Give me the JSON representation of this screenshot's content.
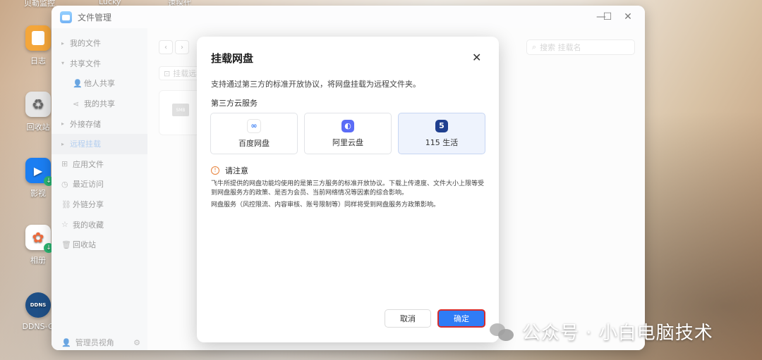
{
  "desktop": {
    "top_labels": [
      "贝勒监控",
      "Lucky",
      "速探代"
    ],
    "icons": [
      {
        "label": "日志",
        "name": "log-app-icon"
      },
      {
        "label": "回收站",
        "name": "recycle-bin-icon"
      },
      {
        "label": "影视",
        "name": "video-app-icon"
      },
      {
        "label": "相册",
        "name": "photos-app-icon"
      },
      {
        "label": "DDNS-G",
        "name": "ddns-app-icon",
        "badge": "DDNS"
      }
    ]
  },
  "window": {
    "title": "文件管理",
    "controls": {
      "close": "✕",
      "maximize": "☐",
      "minimize": "—"
    }
  },
  "sidebar": {
    "items": [
      {
        "label": "我的文件",
        "icon": "▸"
      },
      {
        "label": "共享文件",
        "icon": "▾"
      },
      {
        "label": "他人共享",
        "icon": "👤"
      },
      {
        "label": "我的共享",
        "icon": "⋖"
      },
      {
        "label": "外接存储",
        "icon": "▸"
      },
      {
        "label": "远程挂载",
        "icon": "▸"
      },
      {
        "label": "应用文件",
        "icon": "⊞"
      },
      {
        "label": "最近访问",
        "icon": "◷"
      },
      {
        "label": "外链分享",
        "icon": "⛓"
      },
      {
        "label": "我的收藏",
        "icon": "☆"
      },
      {
        "label": "回收站",
        "icon": "🗑"
      }
    ],
    "footer": {
      "label": "管理员视角"
    }
  },
  "main": {
    "search_placeholder": "搜索 挂载名",
    "mount_button": "挂载远程",
    "smb_label": "SMB"
  },
  "dialog": {
    "title": "挂载网盘",
    "close": "✕",
    "description": "支持通过第三方的标准开放协议，将网盘挂载为远程文件夹。",
    "section_title": "第三方云服务",
    "services": [
      {
        "label": "百度网盘",
        "color": "#3b7ff5",
        "glyph": "∞"
      },
      {
        "label": "阿里云盘",
        "color": "#5b6cf6",
        "glyph": "◐"
      },
      {
        "label": "115 生活",
        "color": "#1f3f8f",
        "glyph": "5",
        "selected": true
      }
    ],
    "notice_title": "请注意",
    "notice_icon": "!",
    "notice_lines": [
      "飞牛所提供的网盘功能均使用的是第三方服务的标准开放协议。下载上传速度、文件大小上限等受到网盘服务方的政策、是否为会员、当前网络情况等因素的综合影响。",
      "网盘服务（风控限流、内容审核、账号限制等）同样将受到网盘服务方政策影响。"
    ],
    "cancel_label": "取消",
    "ok_label": "确定",
    "accent_color": "#2f7cf6",
    "highlight_color": "#d62c2c"
  },
  "watermark": {
    "text": "公众号 · 小白电脑技术"
  }
}
